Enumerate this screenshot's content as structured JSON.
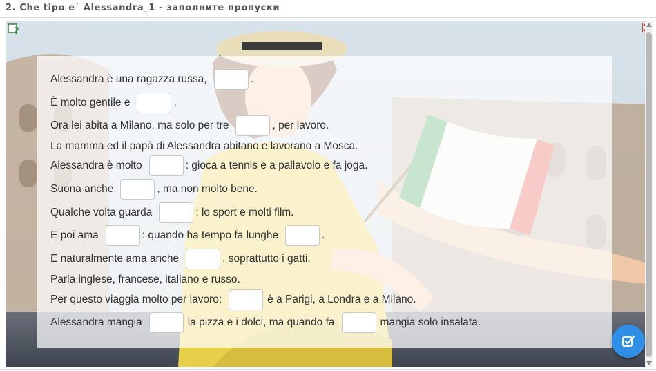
{
  "header": {
    "title": "2. Che tipo e` Alessandra_1 - заполните пропуски"
  },
  "exercise": {
    "lines": [
      {
        "parts": [
          "Alessandra è una ragazza russa,",
          "."
        ]
      },
      {
        "parts": [
          "È molto gentile e",
          "."
        ]
      },
      {
        "parts": [
          "Ora lei abita a Milano, ma solo per tre",
          ", per lavoro."
        ]
      },
      {
        "parts": [
          "La mamma ed il papà di Alessandra abitano e lavorano a Mosca."
        ]
      },
      {
        "parts": [
          "Alessandra è molto",
          ": gioca a tennis e a pallavolo e fa joga."
        ]
      },
      {
        "parts": [
          "Suona anche",
          ", ma non molto bene."
        ]
      },
      {
        "parts": [
          "Qualche volta guarda",
          ": lo sport e molti film."
        ]
      },
      {
        "parts": [
          "E poi ama",
          ": quando ha tempo fa lunghe",
          "."
        ]
      },
      {
        "parts": [
          "E naturalmente ama anche",
          ", soprattutto i gatti."
        ]
      },
      {
        "parts": [
          "Parla inglese, francese, italiano e russo."
        ]
      },
      {
        "parts": [
          "Per questo viaggia molto per lavoro:",
          "è a Parigi, a Londra e a Milano."
        ]
      },
      {
        "parts": [
          "Alessandra mangia",
          "la pizza e i dolci, ma quando fa",
          "mangia solo insalata."
        ]
      }
    ]
  },
  "icons": {
    "help": "help-question-icon",
    "fullscreen": "fullscreen-toggle-icon",
    "check": "check-answers-icon"
  },
  "colors": {
    "check_button": "#2f8fe6",
    "flag_green": "#3aa655",
    "flag_red": "#e0483a"
  }
}
